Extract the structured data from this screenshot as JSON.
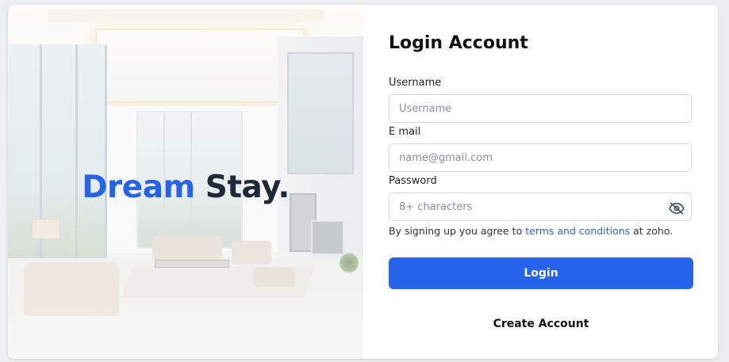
{
  "hero": {
    "brand_part1": "Dream",
    "brand_part2": "Stay.",
    "colors": {
      "accent": "#2563eb",
      "dark": "#1f2937"
    }
  },
  "form": {
    "title": "Login Account",
    "username": {
      "label": "Username",
      "placeholder": "Username",
      "value": ""
    },
    "email": {
      "label": "E mail",
      "placeholder": "name@gmail.com",
      "value": ""
    },
    "password": {
      "label": "Password",
      "placeholder": "8+ characters",
      "value": "",
      "toggle_icon": "eye-slash-icon"
    },
    "terms": {
      "prefix": "By signing up you agree to ",
      "link": "terms and conditions",
      "suffix": " at zoho."
    },
    "login_label": "Login",
    "create_account_label": "Create Account",
    "colors": {
      "primary": "#2563eb"
    }
  }
}
